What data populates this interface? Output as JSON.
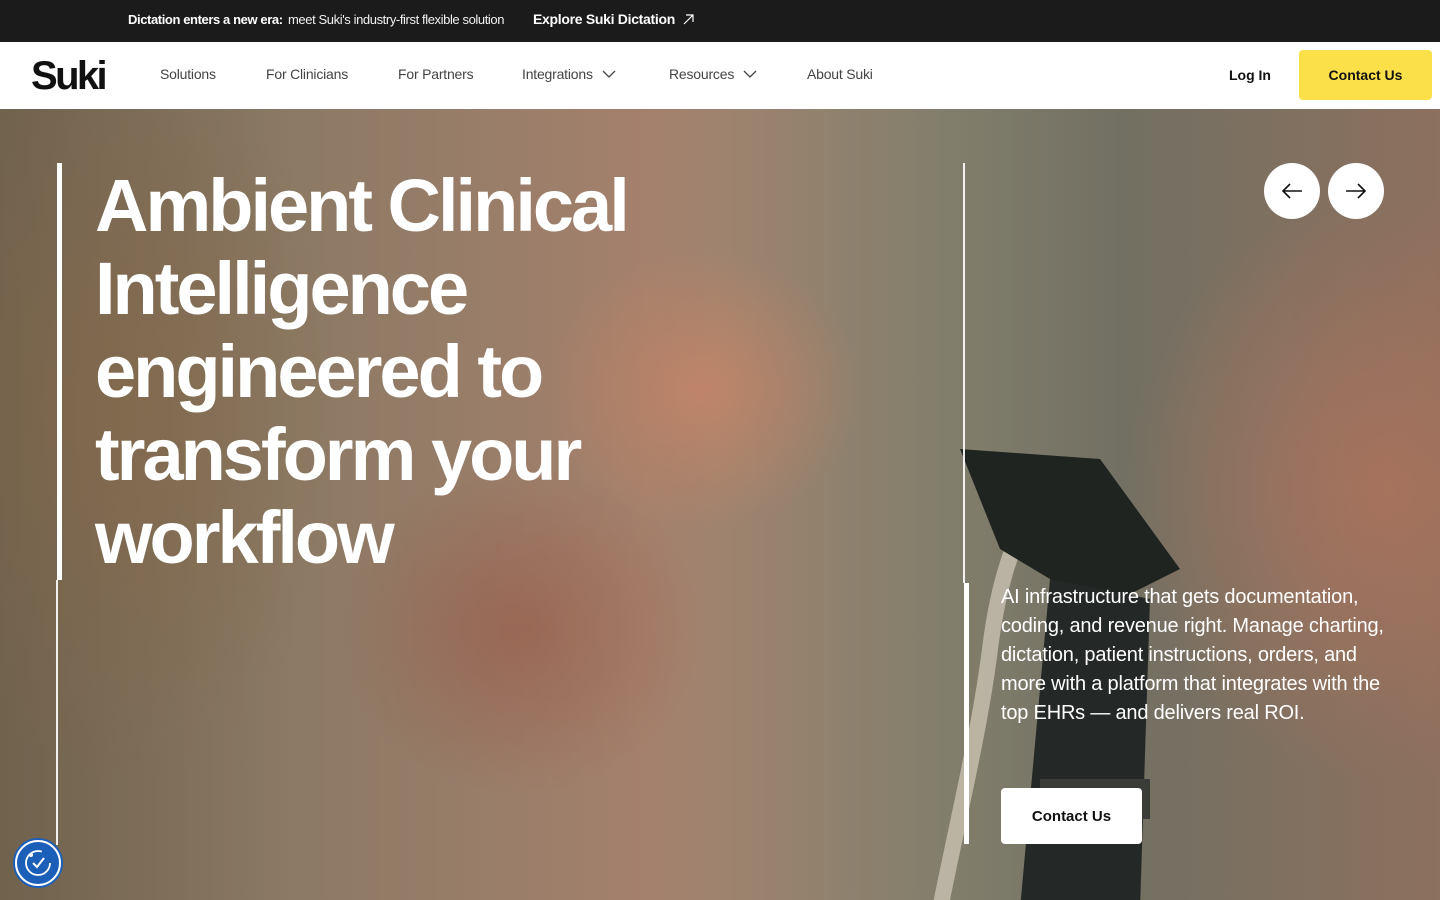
{
  "announcement": {
    "strong": "Dictation enters a new era:",
    "message": "meet Suki's industry-first flexible solution",
    "link": "Explore Suki Dictation"
  },
  "nav": {
    "logo": "Suki",
    "items": [
      {
        "label": "Solutions",
        "dropdown": false
      },
      {
        "label": "For Clinicians",
        "dropdown": false
      },
      {
        "label": "For Partners",
        "dropdown": false
      },
      {
        "label": "Integrations",
        "dropdown": true
      },
      {
        "label": "Resources",
        "dropdown": true
      },
      {
        "label": "About Suki",
        "dropdown": false
      }
    ],
    "login": "Log In",
    "contact": "Contact Us"
  },
  "hero": {
    "headline": "Ambient Clinical Intelligence engineered to transform your workflow",
    "description": "AI infrastructure that gets documentation, coding, and revenue right. Manage charting, dictation, patient instructions, orders, and more with a platform that integrates with the top EHRs — and delivers real ROI.",
    "cta": "Contact Us"
  },
  "colors": {
    "accent": "#fbe04a",
    "dark": "#1b1b1b",
    "a11y": "#1b5fb8"
  },
  "icons": [
    "external-arrow-icon",
    "chevron-down-icon",
    "arrow-left-icon",
    "arrow-right-icon",
    "accessibility-icon"
  ]
}
